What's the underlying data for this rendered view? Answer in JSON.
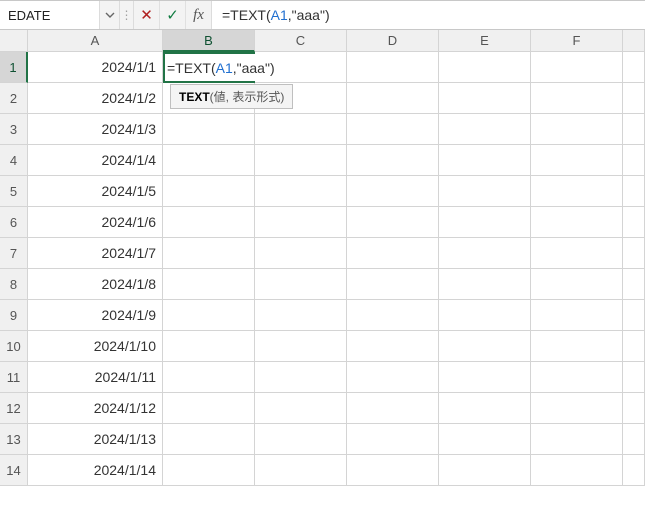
{
  "name_box": {
    "value": "EDATE"
  },
  "fx_icon_label": "fx",
  "formula_bar": {
    "prefix": "=TEXT(",
    "ref": "A1",
    "suffix": ",\"aaa\")"
  },
  "editing_cell": {
    "prefix": "=TEXT(",
    "ref": "A1",
    "suffix": ",\"aaa\")"
  },
  "tooltip": {
    "func": "TEXT",
    "args": "(値, 表示形式)"
  },
  "columns": [
    "A",
    "B",
    "C",
    "D",
    "E",
    "F"
  ],
  "rows": [
    {
      "num": "1",
      "A": "2024/1/1"
    },
    {
      "num": "2",
      "A": "2024/1/2"
    },
    {
      "num": "3",
      "A": "2024/1/3"
    },
    {
      "num": "4",
      "A": "2024/1/4"
    },
    {
      "num": "5",
      "A": "2024/1/5"
    },
    {
      "num": "6",
      "A": "2024/1/6"
    },
    {
      "num": "7",
      "A": "2024/1/7"
    },
    {
      "num": "8",
      "A": "2024/1/8"
    },
    {
      "num": "9",
      "A": "2024/1/9"
    },
    {
      "num": "10",
      "A": "2024/1/10"
    },
    {
      "num": "11",
      "A": "2024/1/11"
    },
    {
      "num": "12",
      "A": "2024/1/12"
    },
    {
      "num": "13",
      "A": "2024/1/13"
    },
    {
      "num": "14",
      "A": "2024/1/14"
    }
  ],
  "active": {
    "col": "B",
    "row": "1"
  }
}
